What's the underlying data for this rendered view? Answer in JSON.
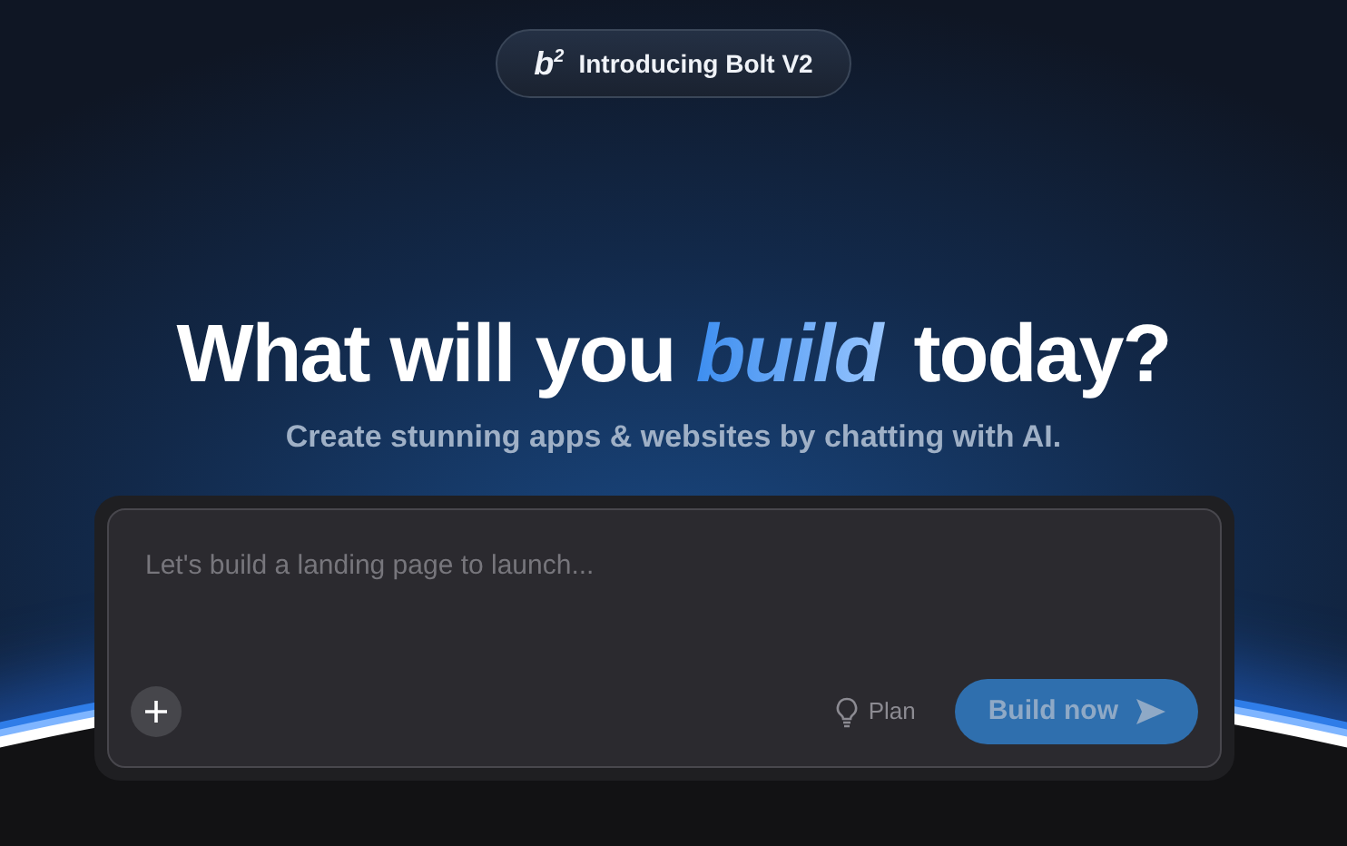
{
  "announcement": {
    "logo_text": "b$^{2}$",
    "label": "Introducing Bolt V2"
  },
  "hero": {
    "headline": "What will you *build* today?",
    "subtitle": "Create stunning apps & websites by chatting with AI."
  },
  "prompt": {
    "placeholder": "Let's build a landing page to launch...",
    "plan_label": "Plan",
    "submit": {
      "label": "Build now",
      "disabled": true
    }
  }
}
